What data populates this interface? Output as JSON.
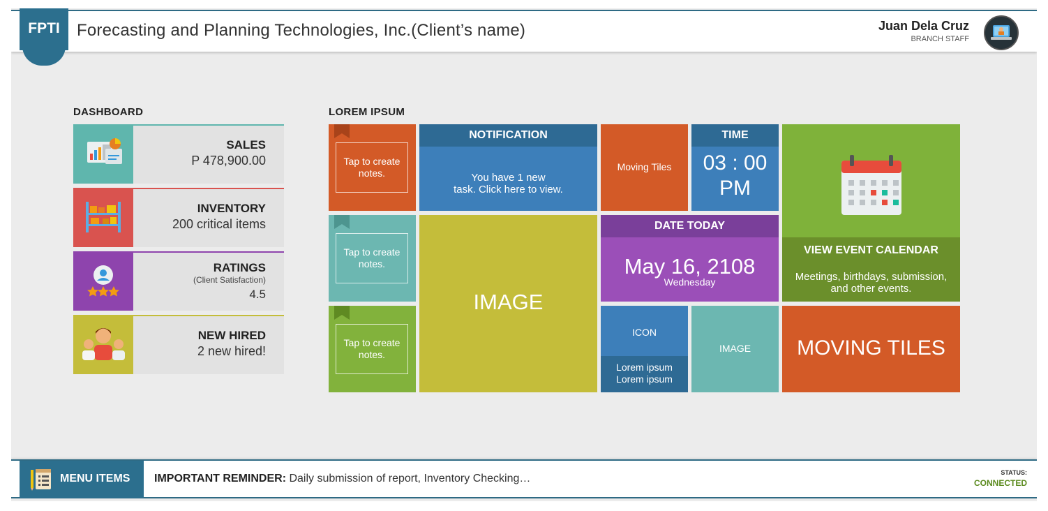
{
  "header": {
    "logo": "FPTI",
    "title": "Forecasting and Planning Technologies, Inc.(Client’s name)",
    "user_name": "Juan Dela Cruz",
    "user_role": "BRANCH STAFF"
  },
  "dashboard": {
    "title": "DASHBOARD",
    "cards": [
      {
        "label": "SALES",
        "value": "P 478,900.00",
        "icon": "sales-chart-icon",
        "accent": "#5fb6ad"
      },
      {
        "label": "INVENTORY",
        "value": "200 critical items",
        "icon": "shelf-icon",
        "accent": "#d9534f"
      },
      {
        "label": "RATINGS",
        "sublabel": "(Client Satisfaction)",
        "value": "4.5",
        "icon": "rating-stars-icon",
        "accent": "#8e44ad"
      },
      {
        "label": "NEW HIRED",
        "value": "2 new hired!",
        "icon": "people-icon",
        "accent": "#c4bd3a"
      }
    ]
  },
  "tiles": {
    "title": "LOREM IPSUM",
    "notes": [
      {
        "text": "Tap to create notes.",
        "color": "#d35a27"
      },
      {
        "text": "Tap to create notes.",
        "color": "#6cb7b1"
      },
      {
        "text": "Tap to create notes.",
        "color": "#82b23c"
      }
    ],
    "notification": {
      "title": "NOTIFICATION",
      "text_line1": "You have 1 new",
      "text_line2": "task. Click here to view.",
      "head_color": "#2e6a94",
      "body_color": "#3d7fba"
    },
    "moving_tiles_small": {
      "text": "Moving Tiles",
      "color": "#d35a27"
    },
    "time": {
      "title": "TIME",
      "time": "03 : 00",
      "ampm": "PM",
      "head_color": "#2e6a94",
      "body_color": "#3d7fba"
    },
    "calendar": {
      "title": "VIEW EVENT CALENDAR",
      "text_line1": "Meetings, birthdays, submission,",
      "text_line2": "and other events.",
      "top_color": "#7fb23a",
      "bottom_color": "#6b8f2b"
    },
    "image_large": {
      "text": "IMAGE",
      "color": "#c4bd3a"
    },
    "date_today": {
      "title": "DATE TODAY",
      "date": "May 16, 2108",
      "weekday": "Wednesday",
      "head_color": "#7a3f9a",
      "body_color": "#9b4fb8"
    },
    "icon_tile": {
      "text": "ICON",
      "line1": "Lorem ipsum",
      "line2": "Lorem ipsum",
      "top_color": "#3d7fba",
      "bottom_color": "#2e6a94"
    },
    "image_small": {
      "text": "IMAGE",
      "color": "#6cb7b1"
    },
    "moving_tiles_large": {
      "text": "MOVING TILES",
      "color": "#d35a27"
    }
  },
  "footer": {
    "menu_label": "MENU ITEMS",
    "reminder_label": "IMPORTANT REMINDER:",
    "reminder_text": " Daily submission of report, Inventory Checking…",
    "status_label": "STATUS:",
    "status_value": "CONNECTED"
  }
}
